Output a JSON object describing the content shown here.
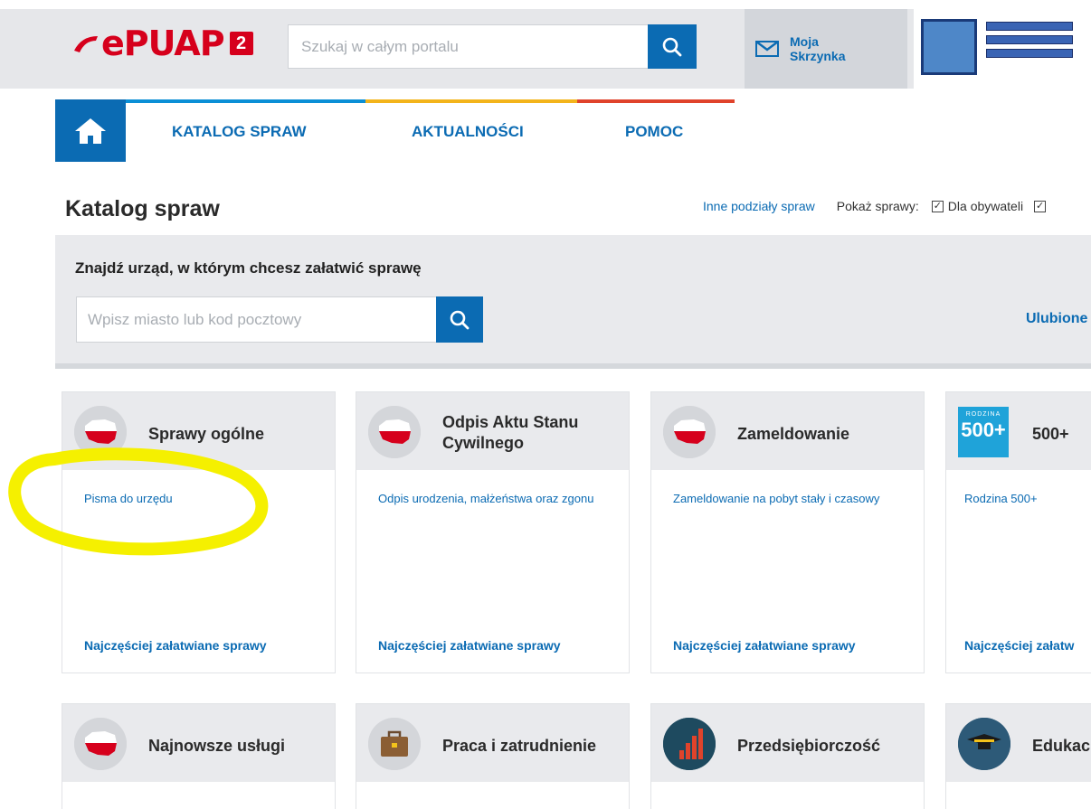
{
  "header": {
    "logo_text": "ePUAP",
    "logo_badge": "2",
    "search_placeholder": "Szukaj w całym portalu",
    "mailbox_label_line1": "Moja",
    "mailbox_label_line2": "Skrzynka",
    "colors": {
      "brand_red": "#d6001c",
      "primary_blue": "#0b6bb3"
    }
  },
  "nav": {
    "items": [
      {
        "label": "KATALOG SPRAW"
      },
      {
        "label": "AKTUALNOŚCI"
      },
      {
        "label": "POMOC"
      }
    ],
    "colorbar": [
      "#0b8fd6",
      "#f3b41b",
      "#e0432b"
    ]
  },
  "page": {
    "title": "Katalog spraw",
    "other_divisions_link": "Inne podziały spraw",
    "show_label": "Pokaż sprawy:",
    "checkbox_citizens": "Dla obywateli",
    "checkbox_citizens_checked": true,
    "checkbox_second_checked": true
  },
  "find_office": {
    "title": "Znajdź urząd, w którym chcesz załatwić sprawę",
    "placeholder": "Wpisz miasto lub kod pocztowy",
    "favorites_link": "Ulubione"
  },
  "cards_row1": [
    {
      "title": "Sprawy ogólne",
      "link": "Pisma do urzędu",
      "footer": "Najczęściej załatwiane sprawy",
      "icon": "poland-map-icon"
    },
    {
      "title_line1": "Odpis Aktu Stanu",
      "title_line2": "Cywilnego",
      "link": "Odpis urodzenia, małżeństwa oraz zgonu",
      "footer": "Najczęściej załatwiane sprawy",
      "icon": "poland-map-icon"
    },
    {
      "title": "Zameldowanie",
      "link": "Zameldowanie na pobyt stały i czasowy",
      "footer": "Najczęściej załatwiane sprawy",
      "icon": "poland-map-icon"
    },
    {
      "title": "500+",
      "link": "Rodzina 500+",
      "footer": "Najczęściej załatw",
      "icon": "rodzina-500-logo",
      "icon_text_top": "RODZINA",
      "icon_text_main": "500+"
    }
  ],
  "cards_row2": [
    {
      "title": "Najnowsze usługi",
      "icon": "poland-map-icon"
    },
    {
      "title": "Praca i zatrudnienie",
      "icon": "briefcase-icon"
    },
    {
      "title": "Przedsiębiorczość",
      "icon": "bar-chart-icon"
    },
    {
      "title": "Edukac",
      "icon": "graduation-cap-icon"
    }
  ]
}
